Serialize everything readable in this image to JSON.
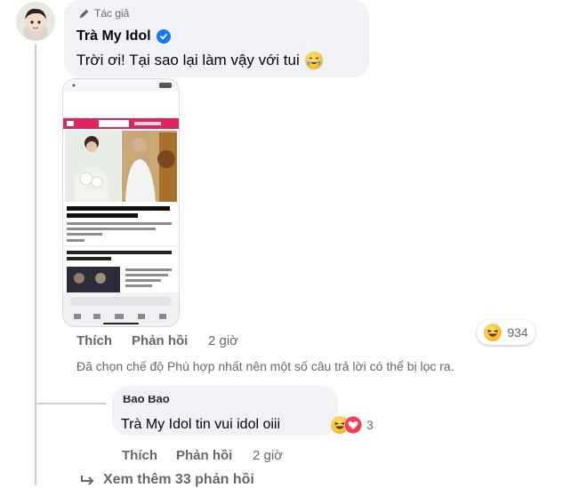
{
  "comment": {
    "author_tag": "Tác giả",
    "author_name": "Trà My Idol",
    "text": "Trời ơi! Tại sao lại làm vậy với tui",
    "text_emoji": "crying-laughing-face-emoji",
    "actions": {
      "like": "Thích",
      "reply": "Phản hồi",
      "time": "2 giờ"
    },
    "reaction_count": "934",
    "reaction_icon": "haha-reaction-icon",
    "filter_note": "Đã chọn chế độ Phù hợp nhất nên một số câu trả lời có thể bị lọc ra."
  },
  "phone_screenshot": {
    "headline": "Trà My Idol lộ vòng 2 to đùng, mang thai lần 3?",
    "snippet_1": "Bị nghi đang mang thai con thứ 3, Trà My Idol nhanh chóng đưa ra phản hồi",
    "read_more": "Xem thêm",
    "headline_2": "Đức Phúc sốc nặng khi được nam chính 'Người ấy Là Ai' trao hoa"
  },
  "reply": {
    "author": "Bảo Bảo",
    "mention": "Trà My Idol",
    "text": " tin vui idol oiii",
    "reaction_count": "3",
    "actions": {
      "like": "Thích",
      "reply": "Phản hồi",
      "time": "2 giờ"
    }
  },
  "more_replies": "Xem thêm 33 phản hồi",
  "colors": {
    "bubble": "#f0f2f5",
    "secondary_text": "#65676b",
    "verified": "#1877f2",
    "brand_red": "#e0245e"
  }
}
